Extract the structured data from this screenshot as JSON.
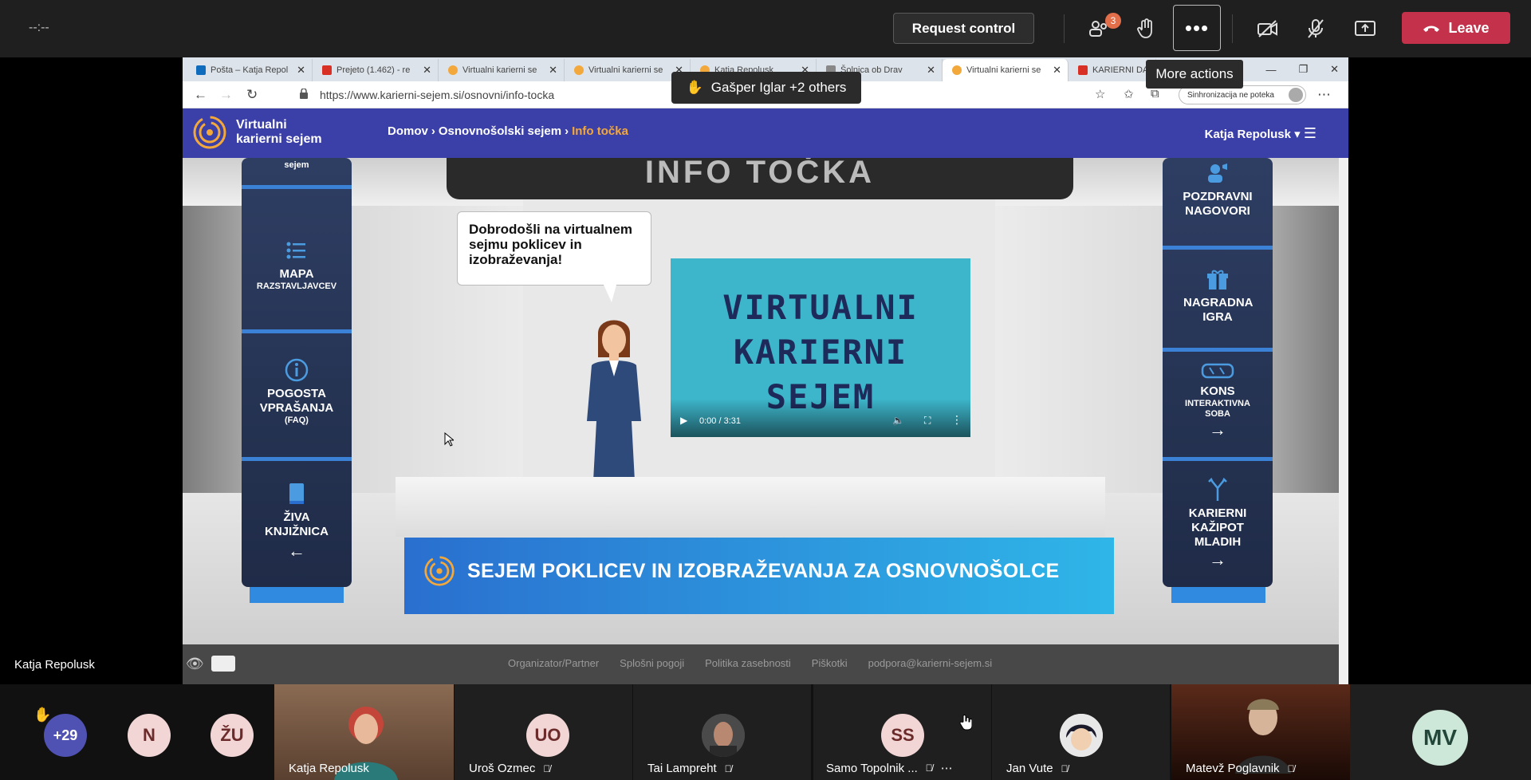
{
  "toolbar": {
    "timer": "--:--",
    "request_control": "Request control",
    "participants_badge": "3",
    "more_actions_tooltip": "More actions",
    "leave": "Leave",
    "raised_hand_notice": "Gašper Iglar +2 others"
  },
  "browser": {
    "tabs": [
      {
        "label": "Pošta – Katja Repol",
        "color": "#0f6cbd"
      },
      {
        "label": "Prejeto (1.462) - re",
        "color": "#d93025"
      },
      {
        "label": "Virtualni karierni se",
        "color": "#f3a83b"
      },
      {
        "label": "Virtualni karierni se",
        "color": "#f3a83b"
      },
      {
        "label": "Katja Repolusk",
        "color": "#f3a83b"
      },
      {
        "label": "Šolnica ob Drav",
        "color": "#888888"
      },
      {
        "label": "Virtualni karierni se",
        "color": "#f3a83b"
      },
      {
        "label": "KARIERNI DA",
        "color": "#d93025"
      }
    ],
    "url": "https://www.karierni-sejem.si/osnovni/info-tocka",
    "sync_label": "Sinhronizacija ne poteka"
  },
  "site": {
    "logo_line1": "Virtualni",
    "logo_line2": "karierni sejem",
    "breadcrumb": [
      "Domov",
      "Osnovnošolski sejem",
      "Info točka"
    ],
    "user": "Katja Repolusk",
    "left_panel_top": "sejem",
    "left_panel": [
      {
        "title": "MAPA",
        "sub": "RAZSTAVLJAVCEV"
      },
      {
        "title": "POGOSTA VPRAŠANJA",
        "sub": "(FAQ)"
      },
      {
        "title": "ŽIVA KNJIŽNICA",
        "sub": ""
      }
    ],
    "right_panel": [
      {
        "title": "POZDRAVNI NAGOVORI",
        "sub": ""
      },
      {
        "title": "NAGRADNA IGRA",
        "sub": ""
      },
      {
        "title": "KONS",
        "sub": "INTERAKTIVNA SOBA"
      },
      {
        "title": "KARIERNI KAŽIPOT MLADIH",
        "sub": ""
      }
    ],
    "sign_text": "INFO TOČKA",
    "speech": "Dobrodošli na virtualnem sejmu poklicev in izobraževanja!",
    "video_title": [
      "VIRTUALNI",
      "KARIERNI",
      "SEJEM"
    ],
    "video_time": "0:00 / 3:31",
    "banner": "SEJEM POKLICEV IN IZOBRAŽEVANJA ZA OSNOVNOŠOLCE",
    "footer_links": [
      "Organizator/Partner",
      "Splošni pogoji",
      "Politika zasebnosti",
      "Piškotki",
      "podpora@karierni-sejem.si"
    ]
  },
  "presenter": "Katja Repolusk",
  "participants": [
    {
      "initials": "+29",
      "name": "",
      "color": "#4f52b2"
    },
    {
      "initials": "N",
      "name": "",
      "color": "#f2d6d6"
    },
    {
      "initials": "ŽU",
      "name": "",
      "color": "#f2d6d6"
    },
    {
      "initials": "",
      "name": "Katja Repolusk",
      "color": "#7a5a4a"
    },
    {
      "initials": "UO",
      "name": "Uroš Ozmec",
      "color": "#f2d6d6"
    },
    {
      "initials": "",
      "name": "Tai Lampreht",
      "color": "#555555"
    },
    {
      "initials": "SS",
      "name": "Samo Topolnik ...",
      "color": "#f2d6d6"
    },
    {
      "initials": "",
      "name": "Jan Vute",
      "color": "#dddddd"
    },
    {
      "initials": "",
      "name": "Matevž Poglavnik",
      "color": "#332211"
    },
    {
      "initials": "MV",
      "name": "",
      "color": "#cde7d9"
    }
  ]
}
